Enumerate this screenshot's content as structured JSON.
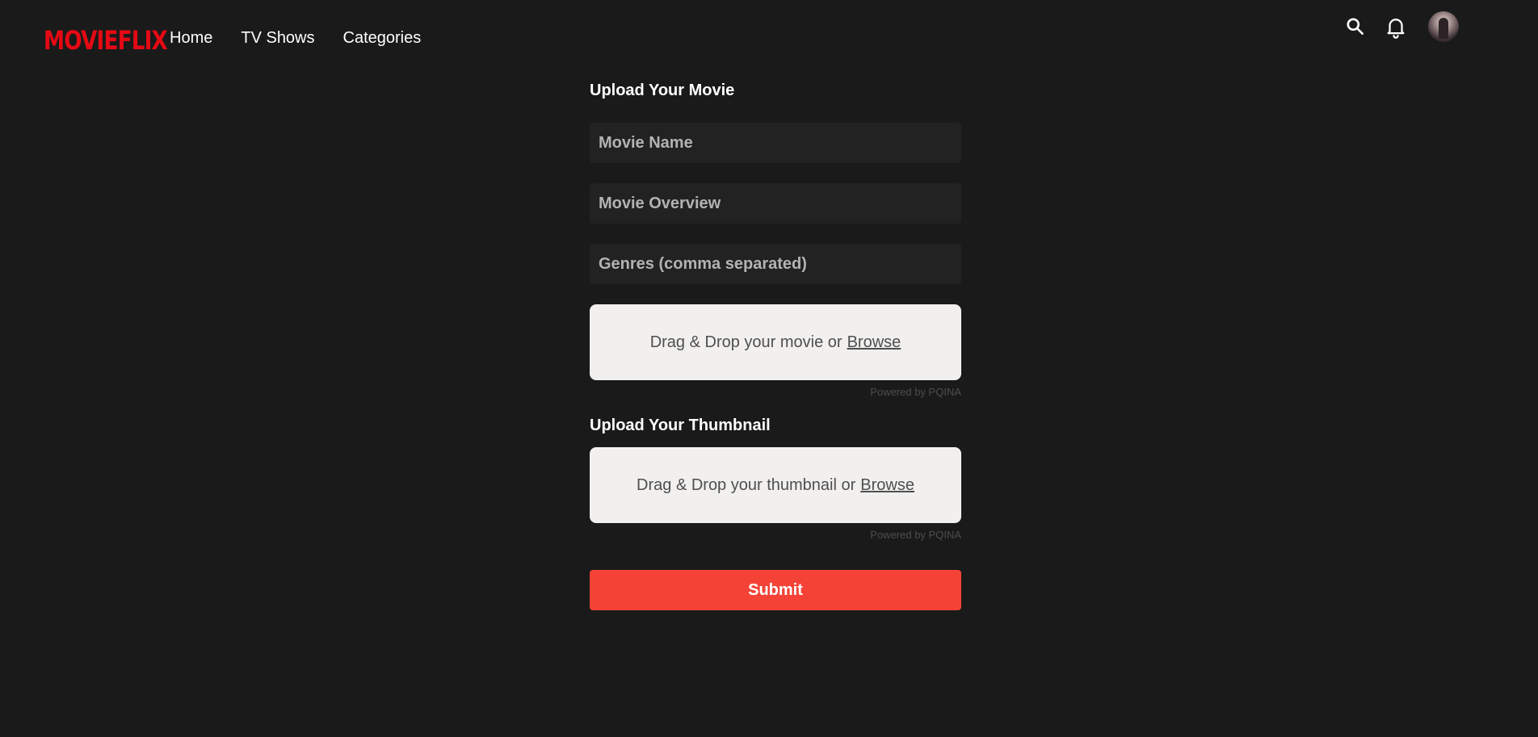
{
  "brand": {
    "name": "MOVIEFLIX",
    "color": "#e50914"
  },
  "nav": {
    "links": [
      "Home",
      "TV Shows",
      "Categories"
    ],
    "icons": [
      "search-icon",
      "bell-icon",
      "avatar"
    ]
  },
  "movie_section": {
    "title": "Upload Your Movie",
    "fields": {
      "name_placeholder": "Movie Name",
      "overview_placeholder": "Movie Overview",
      "genres_placeholder": "Genres (comma separated)"
    },
    "dropzone": {
      "text": "Drag & Drop your movie or",
      "browse": "Browse"
    },
    "credits": "Powered by PQINA"
  },
  "thumbnail_section": {
    "title": "Upload Your Thumbnail",
    "dropzone": {
      "text": "Drag & Drop your thumbnail or",
      "browse": "Browse"
    },
    "credits": "Powered by PQINA"
  },
  "submit": {
    "label": "Submit",
    "color": "#f44336"
  },
  "colors": {
    "background": "#1a1a1a",
    "input_background": "#222222",
    "dropzone_background": "#f1f0ef"
  }
}
